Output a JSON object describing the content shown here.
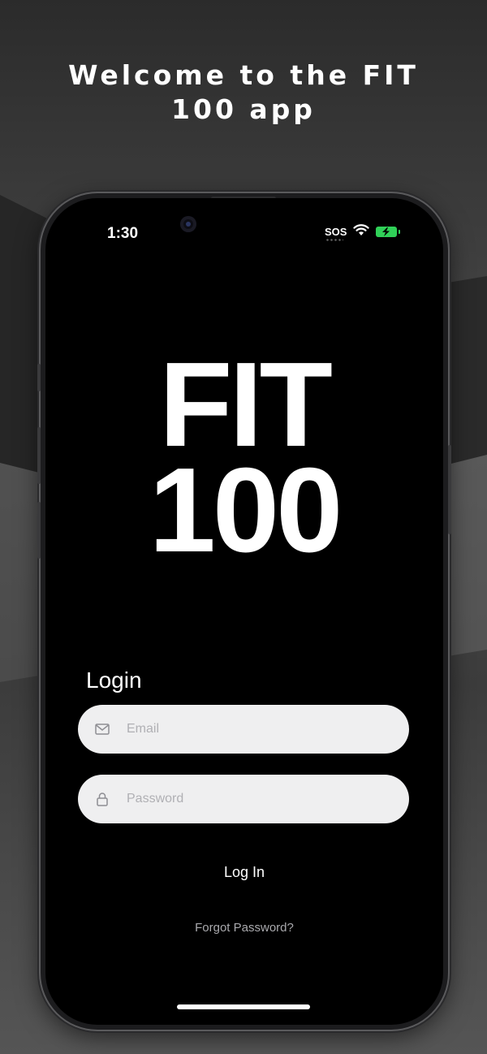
{
  "promo": {
    "title_line1": "Welcome to the FIT",
    "title_line2": "100 app"
  },
  "status_bar": {
    "time": "1:30",
    "carrier": "SOS",
    "battery_state": "charging",
    "battery_color": "#30d158"
  },
  "logo": {
    "line1": "FIT",
    "line2": "100"
  },
  "login": {
    "title": "Login",
    "email_placeholder": "Email",
    "password_placeholder": "Password",
    "submit_label": "Log In",
    "forgot_label": "Forgot Password?"
  },
  "icons": {
    "email": "envelope-icon",
    "password": "lock-icon",
    "wifi": "wifi-icon",
    "battery": "battery-charging-icon"
  }
}
